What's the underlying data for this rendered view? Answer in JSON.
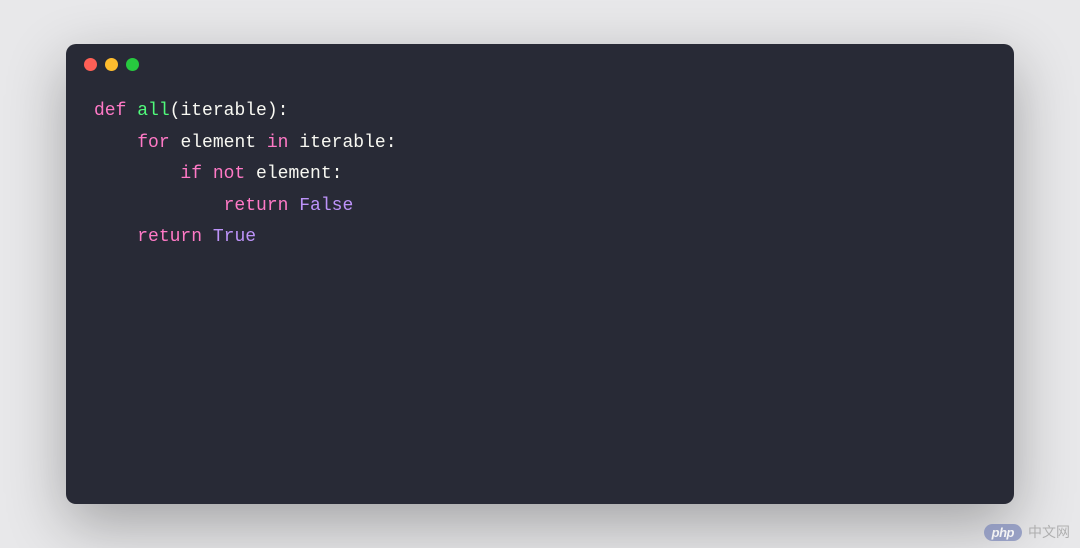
{
  "code": {
    "lines": [
      {
        "indent": 0,
        "tokens": [
          {
            "class": "kw",
            "text": "def "
          },
          {
            "class": "fn",
            "text": "all"
          },
          {
            "class": "pu",
            "text": "("
          },
          {
            "class": "id",
            "text": "iterable"
          },
          {
            "class": "pu",
            "text": "):"
          }
        ]
      },
      {
        "indent": 1,
        "tokens": [
          {
            "class": "kw",
            "text": "for "
          },
          {
            "class": "id",
            "text": "element "
          },
          {
            "class": "op",
            "text": "in "
          },
          {
            "class": "id",
            "text": "iterable"
          },
          {
            "class": "pu",
            "text": ":"
          }
        ]
      },
      {
        "indent": 2,
        "tokens": [
          {
            "class": "kw",
            "text": "if "
          },
          {
            "class": "op",
            "text": "not "
          },
          {
            "class": "id",
            "text": "element"
          },
          {
            "class": "pu",
            "text": ":"
          }
        ]
      },
      {
        "indent": 3,
        "tokens": [
          {
            "class": "kw",
            "text": "return "
          },
          {
            "class": "bo",
            "text": "False"
          }
        ]
      },
      {
        "indent": 1,
        "tokens": [
          {
            "class": "kw",
            "text": "return "
          },
          {
            "class": "bo",
            "text": "True"
          }
        ]
      }
    ]
  },
  "watermark": {
    "badge": "php",
    "text": "中文网"
  }
}
